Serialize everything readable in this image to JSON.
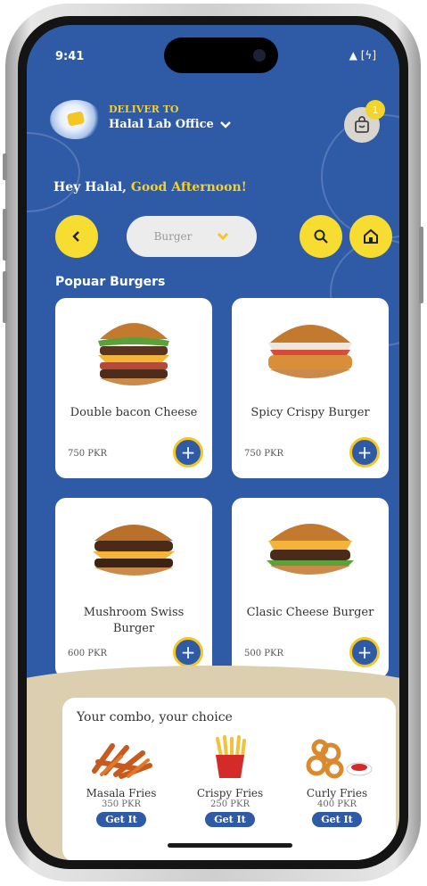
{
  "status_bar": {
    "time": "9:41",
    "icons": "▲ [ϟ]"
  },
  "header": {
    "deliver_to_label": "DELIVER TO",
    "address": "Halal Lab Office",
    "cart_count": "1"
  },
  "greeting": {
    "prefix": "Hey Halal,",
    "accent": "Good Afternoon!"
  },
  "toolbar": {
    "back_icon": "chevron-left-icon",
    "category_value": "Burger",
    "search_icon": "search-icon",
    "home_icon": "home-icon"
  },
  "popular": {
    "title": "Popuar Burgers",
    "items": [
      {
        "name": "Double bacon Cheese",
        "price": "750 PKR"
      },
      {
        "name": "Spicy Crispy Burger",
        "price": "750 PKR"
      },
      {
        "name": "Mushroom Swiss Burger",
        "price": "600 PKR"
      },
      {
        "name": "Clasic Cheese Burger",
        "price": "500 PKR"
      }
    ]
  },
  "combo": {
    "title": "Your combo, your choice",
    "items": [
      {
        "name": "Masala Fries",
        "price": "350 PKR",
        "button": "Get It"
      },
      {
        "name": "Crispy Fries",
        "price": "250 PKR",
        "button": "Get It"
      },
      {
        "name": "Curly Fries",
        "price": "400 PKR",
        "button": "Get It"
      }
    ]
  },
  "colors": {
    "primary_blue": "#2e5aa6",
    "accent_yellow": "#f3d02a",
    "beige": "#dccfb0"
  }
}
